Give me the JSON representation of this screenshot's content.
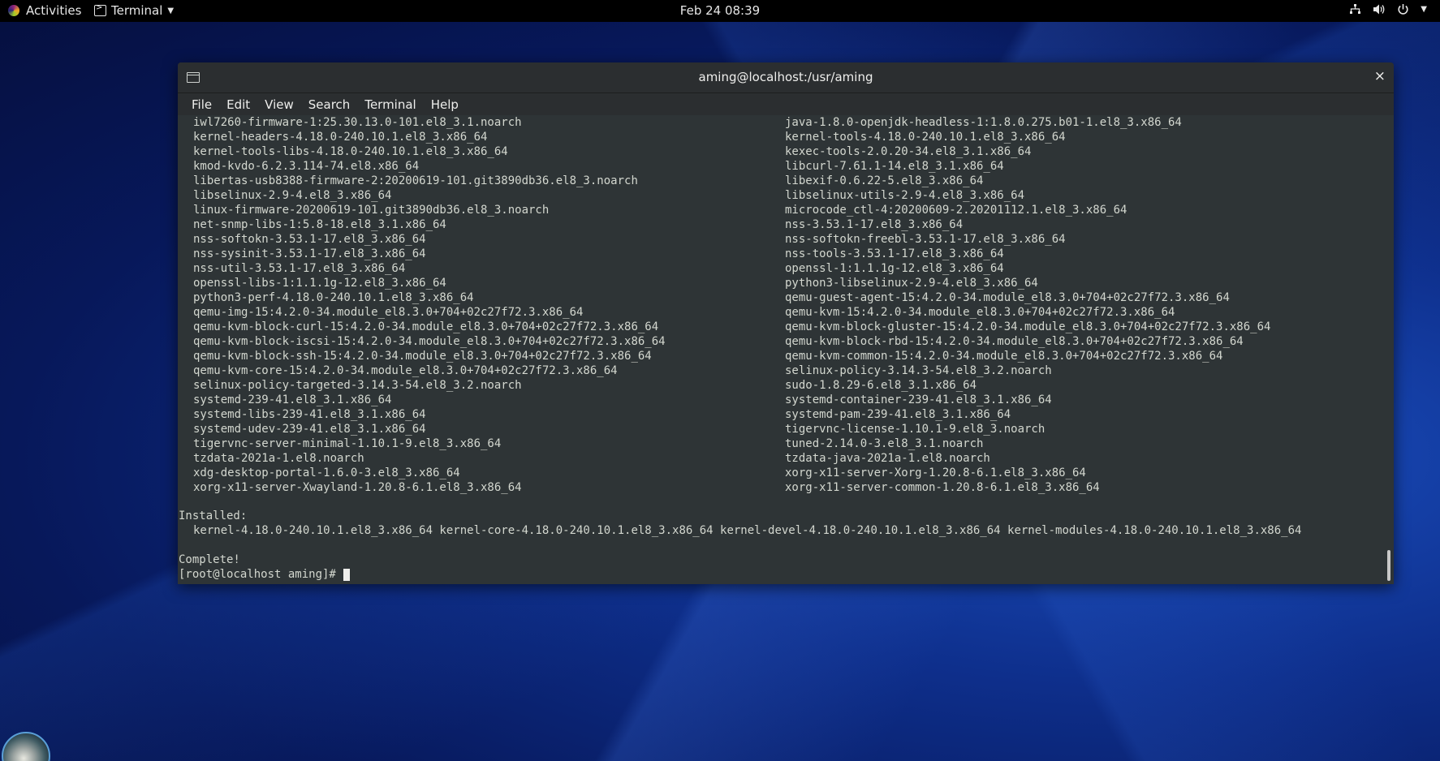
{
  "topbar": {
    "activities": "Activities",
    "app_name": "Terminal",
    "clock": "Feb 24  08:39",
    "icons": [
      "network-icon",
      "volume-icon",
      "power-icon",
      "chevron-down-icon"
    ]
  },
  "window": {
    "title": "aming@localhost:/usr/aming",
    "close": "×",
    "menu": [
      "File",
      "Edit",
      "View",
      "Search",
      "Terminal",
      "Help"
    ]
  },
  "terminal": {
    "packages": [
      [
        "iwl7260-firmware-1:25.30.13.0-101.el8_3.1.noarch",
        "java-1.8.0-openjdk-headless-1:1.8.0.275.b01-1.el8_3.x86_64"
      ],
      [
        "kernel-headers-4.18.0-240.10.1.el8_3.x86_64",
        "kernel-tools-4.18.0-240.10.1.el8_3.x86_64"
      ],
      [
        "kernel-tools-libs-4.18.0-240.10.1.el8_3.x86_64",
        "kexec-tools-2.0.20-34.el8_3.1.x86_64"
      ],
      [
        "kmod-kvdo-6.2.3.114-74.el8.x86_64",
        "libcurl-7.61.1-14.el8_3.1.x86_64"
      ],
      [
        "libertas-usb8388-firmware-2:20200619-101.git3890db36.el8_3.noarch",
        "libexif-0.6.22-5.el8_3.x86_64"
      ],
      [
        "libselinux-2.9-4.el8_3.x86_64",
        "libselinux-utils-2.9-4.el8_3.x86_64"
      ],
      [
        "linux-firmware-20200619-101.git3890db36.el8_3.noarch",
        "microcode_ctl-4:20200609-2.20201112.1.el8_3.x86_64"
      ],
      [
        "net-snmp-libs-1:5.8-18.el8_3.1.x86_64",
        "nss-3.53.1-17.el8_3.x86_64"
      ],
      [
        "nss-softokn-3.53.1-17.el8_3.x86_64",
        "nss-softokn-freebl-3.53.1-17.el8_3.x86_64"
      ],
      [
        "nss-sysinit-3.53.1-17.el8_3.x86_64",
        "nss-tools-3.53.1-17.el8_3.x86_64"
      ],
      [
        "nss-util-3.53.1-17.el8_3.x86_64",
        "openssl-1:1.1.1g-12.el8_3.x86_64"
      ],
      [
        "openssl-libs-1:1.1.1g-12.el8_3.x86_64",
        "python3-libselinux-2.9-4.el8_3.x86_64"
      ],
      [
        "python3-perf-4.18.0-240.10.1.el8_3.x86_64",
        "qemu-guest-agent-15:4.2.0-34.module_el8.3.0+704+02c27f72.3.x86_64"
      ],
      [
        "qemu-img-15:4.2.0-34.module_el8.3.0+704+02c27f72.3.x86_64",
        "qemu-kvm-15:4.2.0-34.module_el8.3.0+704+02c27f72.3.x86_64"
      ],
      [
        "qemu-kvm-block-curl-15:4.2.0-34.module_el8.3.0+704+02c27f72.3.x86_64",
        "qemu-kvm-block-gluster-15:4.2.0-34.module_el8.3.0+704+02c27f72.3.x86_64"
      ],
      [
        "qemu-kvm-block-iscsi-15:4.2.0-34.module_el8.3.0+704+02c27f72.3.x86_64",
        "qemu-kvm-block-rbd-15:4.2.0-34.module_el8.3.0+704+02c27f72.3.x86_64"
      ],
      [
        "qemu-kvm-block-ssh-15:4.2.0-34.module_el8.3.0+704+02c27f72.3.x86_64",
        "qemu-kvm-common-15:4.2.0-34.module_el8.3.0+704+02c27f72.3.x86_64"
      ],
      [
        "qemu-kvm-core-15:4.2.0-34.module_el8.3.0+704+02c27f72.3.x86_64",
        "selinux-policy-3.14.3-54.el8_3.2.noarch"
      ],
      [
        "selinux-policy-targeted-3.14.3-54.el8_3.2.noarch",
        "sudo-1.8.29-6.el8_3.1.x86_64"
      ],
      [
        "systemd-239-41.el8_3.1.x86_64",
        "systemd-container-239-41.el8_3.1.x86_64"
      ],
      [
        "systemd-libs-239-41.el8_3.1.x86_64",
        "systemd-pam-239-41.el8_3.1.x86_64"
      ],
      [
        "systemd-udev-239-41.el8_3.1.x86_64",
        "tigervnc-license-1.10.1-9.el8_3.noarch"
      ],
      [
        "tigervnc-server-minimal-1.10.1-9.el8_3.x86_64",
        "tuned-2.14.0-3.el8_3.1.noarch"
      ],
      [
        "tzdata-2021a-1.el8.noarch",
        "tzdata-java-2021a-1.el8.noarch"
      ],
      [
        "xdg-desktop-portal-1.6.0-3.el8_3.x86_64",
        "xorg-x11-server-Xorg-1.20.8-6.1.el8_3.x86_64"
      ],
      [
        "xorg-x11-server-Xwayland-1.20.8-6.1.el8_3.x86_64",
        "xorg-x11-server-common-1.20.8-6.1.el8_3.x86_64"
      ]
    ],
    "installed_label": "Installed:",
    "installed_line": "kernel-4.18.0-240.10.1.el8_3.x86_64 kernel-core-4.18.0-240.10.1.el8_3.x86_64 kernel-devel-4.18.0-240.10.1.el8_3.x86_64 kernel-modules-4.18.0-240.10.1.el8_3.x86_64",
    "complete": "Complete!",
    "prompt": "[root@localhost aming]# "
  }
}
